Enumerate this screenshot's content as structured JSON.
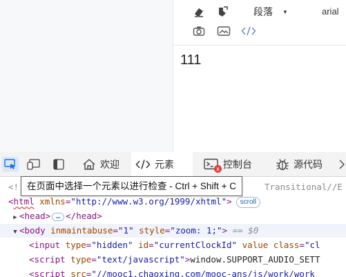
{
  "editor": {
    "toolbar": {
      "eraser_icon": "eraser-icon",
      "brush_icon": "format-brush-icon",
      "paragraph_label": "段落",
      "font_label": "arial",
      "row2_icons": [
        "camera-icon",
        "image-icon",
        "code-icon"
      ]
    },
    "content_text": "111"
  },
  "devtools": {
    "tools": [
      "inspect-element-icon",
      "device-toggle-icon",
      "sidebar-toggle-icon"
    ],
    "tabs": [
      {
        "label": "欢迎",
        "icon": "home-icon"
      },
      {
        "label": "元素",
        "icon": "code-icon"
      },
      {
        "label": "控制台",
        "icon": "console-icon",
        "badge": "x"
      },
      {
        "label": "源代码",
        "icon": "bug-icon"
      }
    ],
    "tooltip": "在页面中选择一个元素以进行检查 - Ctrl + Shift + C",
    "code": {
      "line1_prefix": "<!",
      "line1_suffix": "Transitional//E",
      "line2": {
        "tag_open": "<",
        "tag": "html",
        "attr": "xmlns",
        "val": "\"http://www.w3.org/1999/xhtml\"",
        "close": ">",
        "pill": "scroll"
      },
      "line3": {
        "open": "<head>",
        "ellipsis": "…",
        "close": "</head>"
      },
      "line4": {
        "open": "<body",
        "attr1": "inmaintabuse",
        "val1": "\"1\"",
        "attr2": "style",
        "val2": "\"zoom: 1;\"",
        "close": ">",
        "eq": "== $0"
      },
      "line5": {
        "open": "<input",
        "attr1": "type",
        "val1": "\"hidden\"",
        "attr2": "id",
        "val2": "\"currentClockId\"",
        "attr3": "value",
        "attr4": "class",
        "val4": "\"cl"
      },
      "line6": {
        "open": "<script",
        "attr1": "type",
        "val1": "\"text/javascript\"",
        "close": ">",
        "text": "window.SUPPORT_AUDIO_SETT"
      },
      "line7": {
        "open": "<script",
        "attr1": "src",
        "val1": "\"//mooc1.chaoxing.com/mooc-ans/js/work/work"
      }
    }
  }
}
